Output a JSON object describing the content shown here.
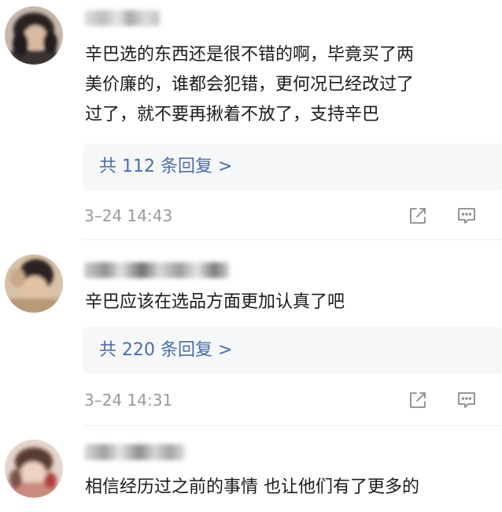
{
  "comments": [
    {
      "text_lines": [
        "辛巴选的东西还是很不错的啊，毕竟买了两",
        "美价廉的，谁都会犯错，更何况已经改过了",
        "过了，就不要再揪着不放了，支持辛巴"
      ],
      "replies_label": "共 112 条回复 >",
      "timestamp": "3–24 14:43"
    },
    {
      "text_lines": [
        "辛巴应该在选品方面更加认真了吧"
      ],
      "replies_label": "共 220 条回复 >",
      "timestamp": "3–24 14:31"
    },
    {
      "text_lines": [
        "相信经历过之前的事情 也让他们有了更多的"
      ]
    }
  ],
  "icons": {
    "share": "share-icon",
    "reply": "comment-icon"
  },
  "colors": {
    "link": "#4a6ea8",
    "timestamp": "#9a9a9a",
    "reply_box": "#f6f7f9",
    "icon": "#8a8a8a"
  }
}
